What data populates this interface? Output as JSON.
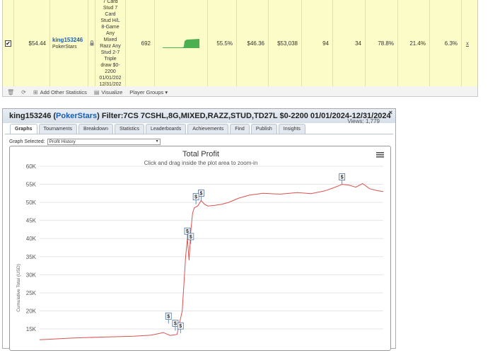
{
  "stats_row": {
    "checked": true,
    "checkmark": "✔",
    "col1": "$54.44",
    "player_name": "king153246",
    "player_site": "PokerStars",
    "player_icon": "lock-icon",
    "filter_lines": [
      "7 Card",
      "Stud 7",
      "Card",
      "Stud H/L",
      "8-Game",
      "Any",
      "Mixed",
      "Razz Any",
      "Stud 2-7",
      "Triple",
      "draw $0-",
      "2200",
      "01/01/202",
      "12/31/202"
    ],
    "games": "692",
    "roi": "55.5%",
    "avg_profit": "$46.36",
    "total_profit": "$53,038",
    "c_94": "94",
    "c_34": "34",
    "pct1": "78.8%",
    "pct2": "21.4%",
    "pct3": "6.3%",
    "remove_link": "x",
    "spark_color": "#4caf50"
  },
  "toolbar": {
    "add_stats": "Add Other Statistics",
    "visualize": "Visualize",
    "player_groups": "Player Groups ▾"
  },
  "panel": {
    "title_player": "king153246 (",
    "title_site": "PokerStars",
    "title_rest": ") Filter:7CS 7CSHL,8G,MIXED,RAZZ,STUD,TD27L $0-2200 01/01/2024-12/31/2024",
    "views": "Views: 1,779",
    "close": "×",
    "tabs": [
      "Graphs",
      "Tournaments",
      "Breakdown",
      "Statistics",
      "Leaderboards",
      "Achievements",
      "Find",
      "Publish",
      "Insights"
    ],
    "graph_selected_label": "Graph Selected:",
    "graph_selected_value": "Profit History"
  },
  "chart_data": {
    "type": "line",
    "title": "Total Profit",
    "subtitle": "Click and drag inside the plot area to zoom-in",
    "ylabel": "Cumulative Total (USD)",
    "ylim": [
      15000,
      60000
    ],
    "yticks": [
      "60K",
      "55K",
      "50K",
      "45K",
      "40K",
      "35K",
      "30K",
      "25K",
      "20K",
      "15K"
    ],
    "line_color": "#d9534f",
    "menu_icon": "hamburger-menu-icon",
    "series": [
      {
        "values": [
          [
            0,
            12000
          ],
          [
            20,
            12500
          ],
          [
            40,
            12800
          ],
          [
            55,
            13000
          ],
          [
            65,
            13300
          ],
          [
            72,
            14000
          ],
          [
            76,
            13200
          ],
          [
            80,
            13500
          ],
          [
            83,
            20000
          ],
          [
            85,
            35000
          ],
          [
            86,
            40000
          ],
          [
            87,
            34000
          ],
          [
            88,
            42000
          ],
          [
            89,
            47000
          ],
          [
            90,
            48500
          ],
          [
            92,
            49000
          ],
          [
            94,
            50500
          ],
          [
            96,
            49500
          ],
          [
            98,
            49000
          ],
          [
            102,
            49200
          ],
          [
            106,
            49500
          ],
          [
            110,
            50000
          ],
          [
            116,
            51200
          ],
          [
            122,
            52000
          ],
          [
            130,
            52500
          ],
          [
            140,
            52300
          ],
          [
            150,
            52700
          ],
          [
            158,
            52400
          ],
          [
            166,
            53200
          ],
          [
            172,
            54200
          ],
          [
            176,
            55000
          ],
          [
            180,
            54800
          ],
          [
            184,
            54200
          ],
          [
            188,
            55200
          ],
          [
            192,
            53800
          ],
          [
            196,
            53300
          ],
          [
            200,
            53000
          ]
        ]
      }
    ],
    "markers": [
      {
        "x": 176,
        "y": 55000,
        "label": "$"
      },
      {
        "x": 94,
        "y": 50500,
        "label": "$"
      },
      {
        "x": 91,
        "y": 49500,
        "label": "$"
      },
      {
        "x": 86,
        "y": 40000,
        "label": "$"
      },
      {
        "x": 88,
        "y": 38500,
        "label": "$"
      },
      {
        "x": 75,
        "y": 16500,
        "label": "$"
      },
      {
        "x": 79,
        "y": 14500,
        "label": "$"
      },
      {
        "x": 82,
        "y": 13800,
        "label": "$"
      }
    ]
  }
}
